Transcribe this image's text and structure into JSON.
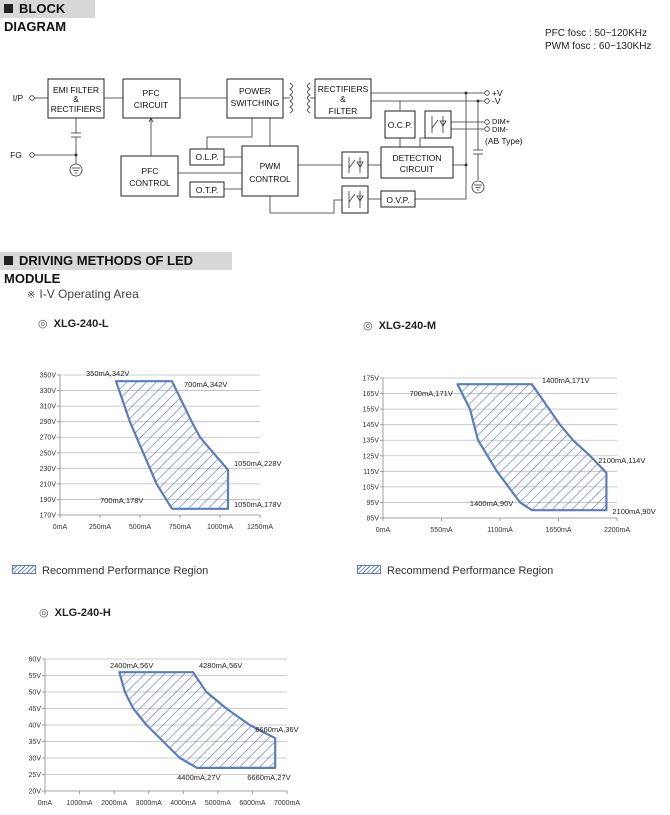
{
  "block_diagram": {
    "header": "BLOCK DIAGRAM",
    "notes": [
      "PFC fosc : 50~120KHz",
      "PWM fosc : 60~130KHz"
    ],
    "blocks": {
      "emi": [
        "EMI FILTER",
        "&",
        "RECTIFIERS"
      ],
      "pfc_circuit": [
        "PFC",
        "CIRCUIT"
      ],
      "power_switching": [
        "POWER",
        "SWITCHING"
      ],
      "rectifiers_filter": [
        "RECTIFIERS",
        "&",
        "FILTER"
      ],
      "pfc_control": [
        "PFC",
        "CONTROL"
      ],
      "olp": "O.L.P.",
      "otp": "O.T.P.",
      "pwm_control": [
        "PWM",
        "CONTROL"
      ],
      "ocp": "O.C.P.",
      "detection": [
        "DETECTION",
        "CIRCUIT"
      ],
      "ovp": "O.V.P."
    },
    "terminals": {
      "ip": "I/P",
      "fg": "FG",
      "vplus": "+V",
      "vminus": "-V",
      "dimplus": "DIM+",
      "dimminus": "DIM-",
      "ab_type": "(AB Type)"
    }
  },
  "driving": {
    "header": "DRIVING METHODS OF LED MODULE",
    "subtitle_icon": "※",
    "subtitle": "I-V Operating Area",
    "model_icon": "◎",
    "legend_label": "Recommend Performance Region"
  },
  "colors": {
    "region": "#5b7dc0",
    "grid": "#bdbdbd",
    "header_bg": "#d8d8d8"
  },
  "chart_data": [
    {
      "type": "area",
      "title": "XLG-240-L",
      "xlim": [
        0,
        1250
      ],
      "ylim": [
        170,
        350
      ],
      "xticks": [
        "0mA",
        "250mA",
        "500mA",
        "750mA",
        "1000mA",
        "1250mA"
      ],
      "xtick_values": [
        0,
        250,
        500,
        750,
        1000,
        1250
      ],
      "yticks": [
        "170V",
        "190V",
        "210V",
        "230V",
        "250V",
        "270V",
        "290V",
        "310V",
        "330V",
        "350V"
      ],
      "ytick_values": [
        170,
        190,
        210,
        230,
        250,
        270,
        290,
        310,
        330,
        350
      ],
      "grid": "horizontal",
      "region": [
        [
          350,
          342
        ],
        [
          700,
          342
        ],
        [
          823,
          290
        ],
        [
          875,
          270
        ],
        [
          958,
          250
        ],
        [
          1050,
          228
        ],
        [
          1050,
          178
        ],
        [
          700,
          178
        ],
        [
          604,
          210
        ],
        [
          520,
          250
        ],
        [
          437,
          290
        ],
        [
          350,
          342
        ]
      ],
      "annotations": [
        {
          "text": "350mA,342V",
          "x": 350,
          "y": 342
        },
        {
          "text": "700mA,342V",
          "x": 700,
          "y": 342
        },
        {
          "text": "1050mA,228V",
          "x": 1050,
          "y": 228
        },
        {
          "text": "700mA,178V",
          "x": 700,
          "y": 178
        },
        {
          "text": "1050mA,178V",
          "x": 1050,
          "y": 178
        }
      ],
      "legend": "Recommend Performance Region"
    },
    {
      "type": "area",
      "title": "XLG-240-M",
      "xlim": [
        0,
        2200
      ],
      "ylim": [
        85,
        175
      ],
      "xticks": [
        "0mA",
        "550mA",
        "1100mA",
        "1650mA",
        "2200mA"
      ],
      "xtick_values": [
        0,
        550,
        1100,
        1650,
        2200
      ],
      "yticks": [
        "85V",
        "95V",
        "105V",
        "115V",
        "125V",
        "135V",
        "145V",
        "155V",
        "165V",
        "175V"
      ],
      "ytick_values": [
        85,
        95,
        105,
        115,
        125,
        135,
        145,
        155,
        165,
        175
      ],
      "grid": "horizontal",
      "region": [
        [
          700,
          171
        ],
        [
          1400,
          171
        ],
        [
          1664,
          145
        ],
        [
          1786,
          135
        ],
        [
          1946,
          125
        ],
        [
          2100,
          114
        ],
        [
          2100,
          90
        ],
        [
          1400,
          90
        ],
        [
          1288,
          95
        ],
        [
          1071,
          115
        ],
        [
          893,
          135
        ],
        [
          818,
          155
        ],
        [
          700,
          171
        ]
      ],
      "annotations": [
        {
          "text": "700mA,171V",
          "x": 700,
          "y": 171
        },
        {
          "text": "1400mA,171V",
          "x": 1400,
          "y": 171
        },
        {
          "text": "2100mA,114V",
          "x": 2100,
          "y": 114
        },
        {
          "text": "1400mA,90V",
          "x": 1400,
          "y": 90
        },
        {
          "text": "2100mA,90V",
          "x": 2100,
          "y": 90
        }
      ],
      "legend": "Recommend Performance Region"
    },
    {
      "type": "area",
      "title": "XLG-240-H",
      "xlim": [
        0,
        7000
      ],
      "ylim": [
        20,
        60
      ],
      "xticks": [
        "0mA",
        "1000mA",
        "2000mA",
        "3000mA",
        "4000mA",
        "5000mA",
        "6000mA",
        "7000mA"
      ],
      "xtick_values": [
        0,
        1000,
        2000,
        3000,
        4000,
        5000,
        6000,
        7000
      ],
      "yticks": [
        "20V",
        "25V",
        "30V",
        "35V",
        "40V",
        "45V",
        "50V",
        "55V",
        "60V"
      ],
      "ytick_values": [
        20,
        25,
        30,
        35,
        40,
        45,
        50,
        55,
        60
      ],
      "grid": "horizontal",
      "region": [
        [
          2150,
          56
        ],
        [
          4280,
          56
        ],
        [
          4670,
          50
        ],
        [
          5248,
          45
        ],
        [
          5922,
          40
        ],
        [
          6660,
          36
        ],
        [
          6660,
          27
        ],
        [
          4400,
          27
        ],
        [
          3900,
          30
        ],
        [
          3419,
          35
        ],
        [
          2937,
          40
        ],
        [
          2552,
          45
        ],
        [
          2311,
          50
        ],
        [
          2150,
          56
        ]
      ],
      "annotations": [
        {
          "text": "2400mA,56V",
          "x": 2400,
          "y": 56
        },
        {
          "text": "4280mA,56V",
          "x": 4280,
          "y": 56
        },
        {
          "text": "6660mA,36V",
          "x": 6660,
          "y": 36
        },
        {
          "text": "4400mA,27V",
          "x": 4400,
          "y": 27
        },
        {
          "text": "6660mA,27V",
          "x": 6660,
          "y": 27
        }
      ]
    }
  ]
}
